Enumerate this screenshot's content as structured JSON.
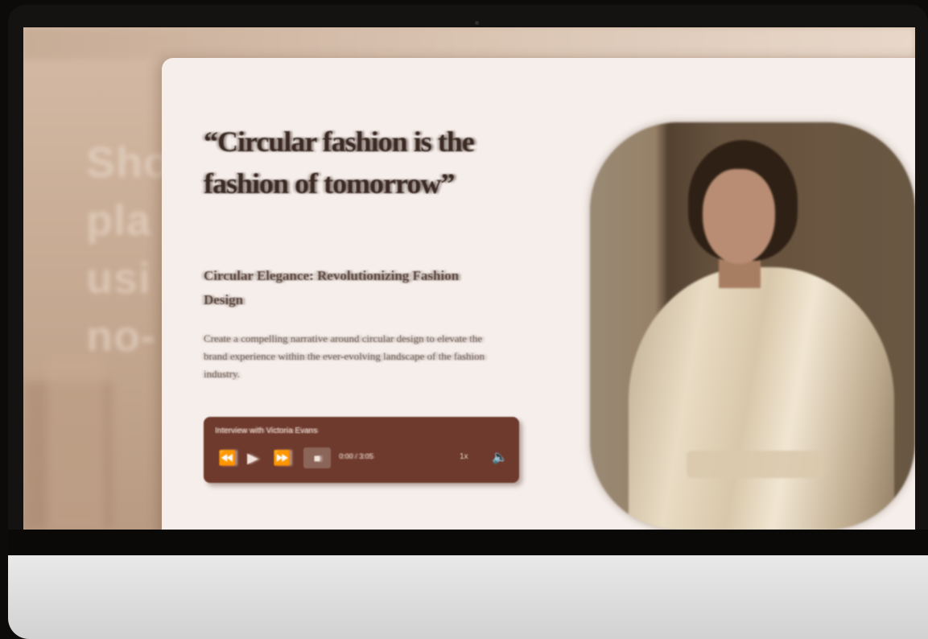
{
  "background_text": "Sho pla usi no-",
  "card": {
    "quote": "“Circular fashion is the fashion of tomorrow”",
    "subtitle": "Circular Elegance: Revolutionizing Fashion Design",
    "body": "Create a compelling narrative around circular design to elevate the brand experience within the ever-evolving landscape of the fashion industry."
  },
  "player": {
    "title": "Interview with Victoria Evans",
    "rewind_icon": "rewind-icon",
    "play_icon": "play-icon",
    "forward_icon": "fast-forward-icon",
    "stop_icon": "stop-icon",
    "time": "0:00 / 3:05",
    "speed": "1x",
    "volume_icon": "volume-icon"
  },
  "photo": {
    "subject": "woman-in-satin-blouse-photo"
  },
  "colors": {
    "card_bg": "#f6eeea",
    "player_bg": "#6e3a2d",
    "heading": "#3b2a24",
    "screen_bg": "#c9ad96"
  }
}
